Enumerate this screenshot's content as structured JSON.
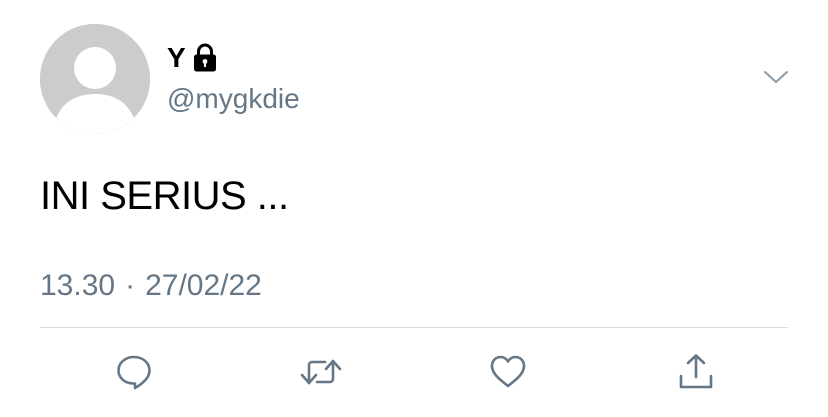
{
  "user": {
    "display_name": "Y",
    "handle": "@mygkdie",
    "protected_icon": "lock-icon",
    "avatar_icon": "default-avatar-icon"
  },
  "tweet": {
    "text": "INI SERIUS ...",
    "time": "13.30",
    "separator": "·",
    "date": "27/02/22"
  },
  "actions": {
    "reply_icon": "reply-icon",
    "retweet_icon": "retweet-icon",
    "like_icon": "heart-icon",
    "share_icon": "share-icon",
    "menu_icon": "chevron-down-icon"
  },
  "colors": {
    "secondary_text": "#657786",
    "avatar_bg": "#cccccc",
    "divider": "#d8dde1"
  }
}
